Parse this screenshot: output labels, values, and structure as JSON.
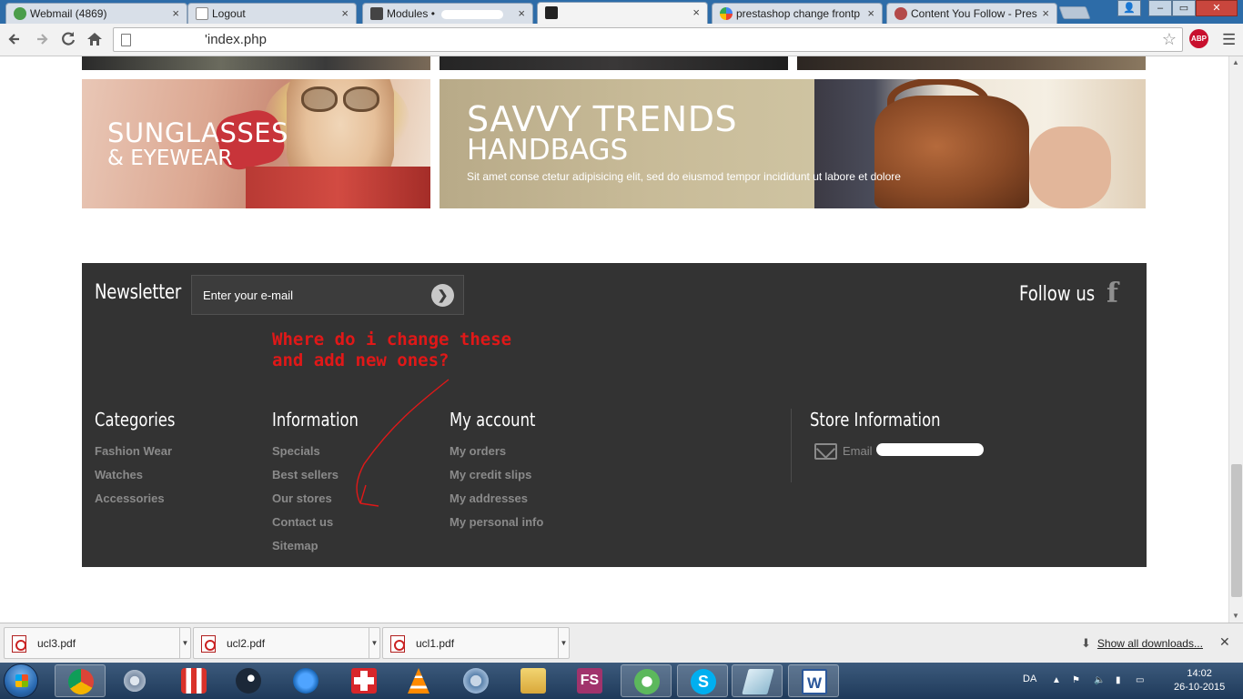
{
  "browser": {
    "tabs": [
      {
        "label": "Webmail (4869)",
        "active": false
      },
      {
        "label": "Logout",
        "active": false
      },
      {
        "label": "Modules •",
        "active": false
      },
      {
        "label": "",
        "active": true
      },
      {
        "label": "prestashop change frontp",
        "active": false
      },
      {
        "label": "Content You Follow - Pres",
        "active": false
      }
    ],
    "tab_close_glyph": "×",
    "window_controls": {
      "user": "👤",
      "minimize": "–",
      "maximize": "▭",
      "close": "✕"
    },
    "url": "'index.php",
    "abp_label": "ABP",
    "icons": {
      "back": "back-icon",
      "forward": "forward-icon",
      "reload": "reload-icon",
      "home": "home-icon",
      "star": "star-icon",
      "menu": "menu-icon"
    }
  },
  "banners": {
    "sunglasses": {
      "title": "SUNGLASSES",
      "subtitle": "& EYEWEAR"
    },
    "handbags": {
      "title": "SAVVY TRENDS",
      "subtitle": "HANDBAGS",
      "text": "Sit amet conse ctetur adipisicing elit, sed do eiusmod tempor incididunt ut labore et dolore"
    }
  },
  "footer": {
    "newsletter": {
      "title": "Newsletter",
      "placeholder": "Enter your e-mail",
      "submit_glyph": "❯"
    },
    "follow": {
      "title": "Follow us",
      "facebook_glyph": "f"
    },
    "annotation": {
      "line1": "Where do i change these",
      "line2": "and add new ones?"
    },
    "columns": {
      "categories": {
        "title": "Categories",
        "links": [
          "Fashion Wear",
          "Watches",
          "Accessories"
        ]
      },
      "information": {
        "title": "Information",
        "links": [
          "Specials",
          "Best sellers",
          "Our stores",
          "Contact us",
          "Sitemap"
        ]
      },
      "account": {
        "title": "My account",
        "links": [
          "My orders",
          "My credit slips",
          "My addresses",
          "My personal info"
        ]
      },
      "store": {
        "title": "Store Information",
        "email_label": "Email"
      }
    }
  },
  "downloads": {
    "items": [
      "ucl3.pdf",
      "ucl2.pdf",
      "ucl1.pdf"
    ],
    "show_all": "Show all downloads...",
    "close_glyph": "✕"
  },
  "taskbar": {
    "apps": [
      "chrome",
      "settings",
      "popcorn-time",
      "steam",
      "thunder",
      "first-aid",
      "vlc",
      "browser",
      "file-explorer",
      "fs",
      "utorrent",
      "skype",
      "notes",
      "word"
    ],
    "lang": "DA",
    "time": "14:02",
    "date": "26-10-2015"
  },
  "colors": {
    "footer_bg": "#333333",
    "footer_link": "#8a8a8a",
    "annotation": "#e01818",
    "chrome_frame": "#2d6ca8"
  }
}
